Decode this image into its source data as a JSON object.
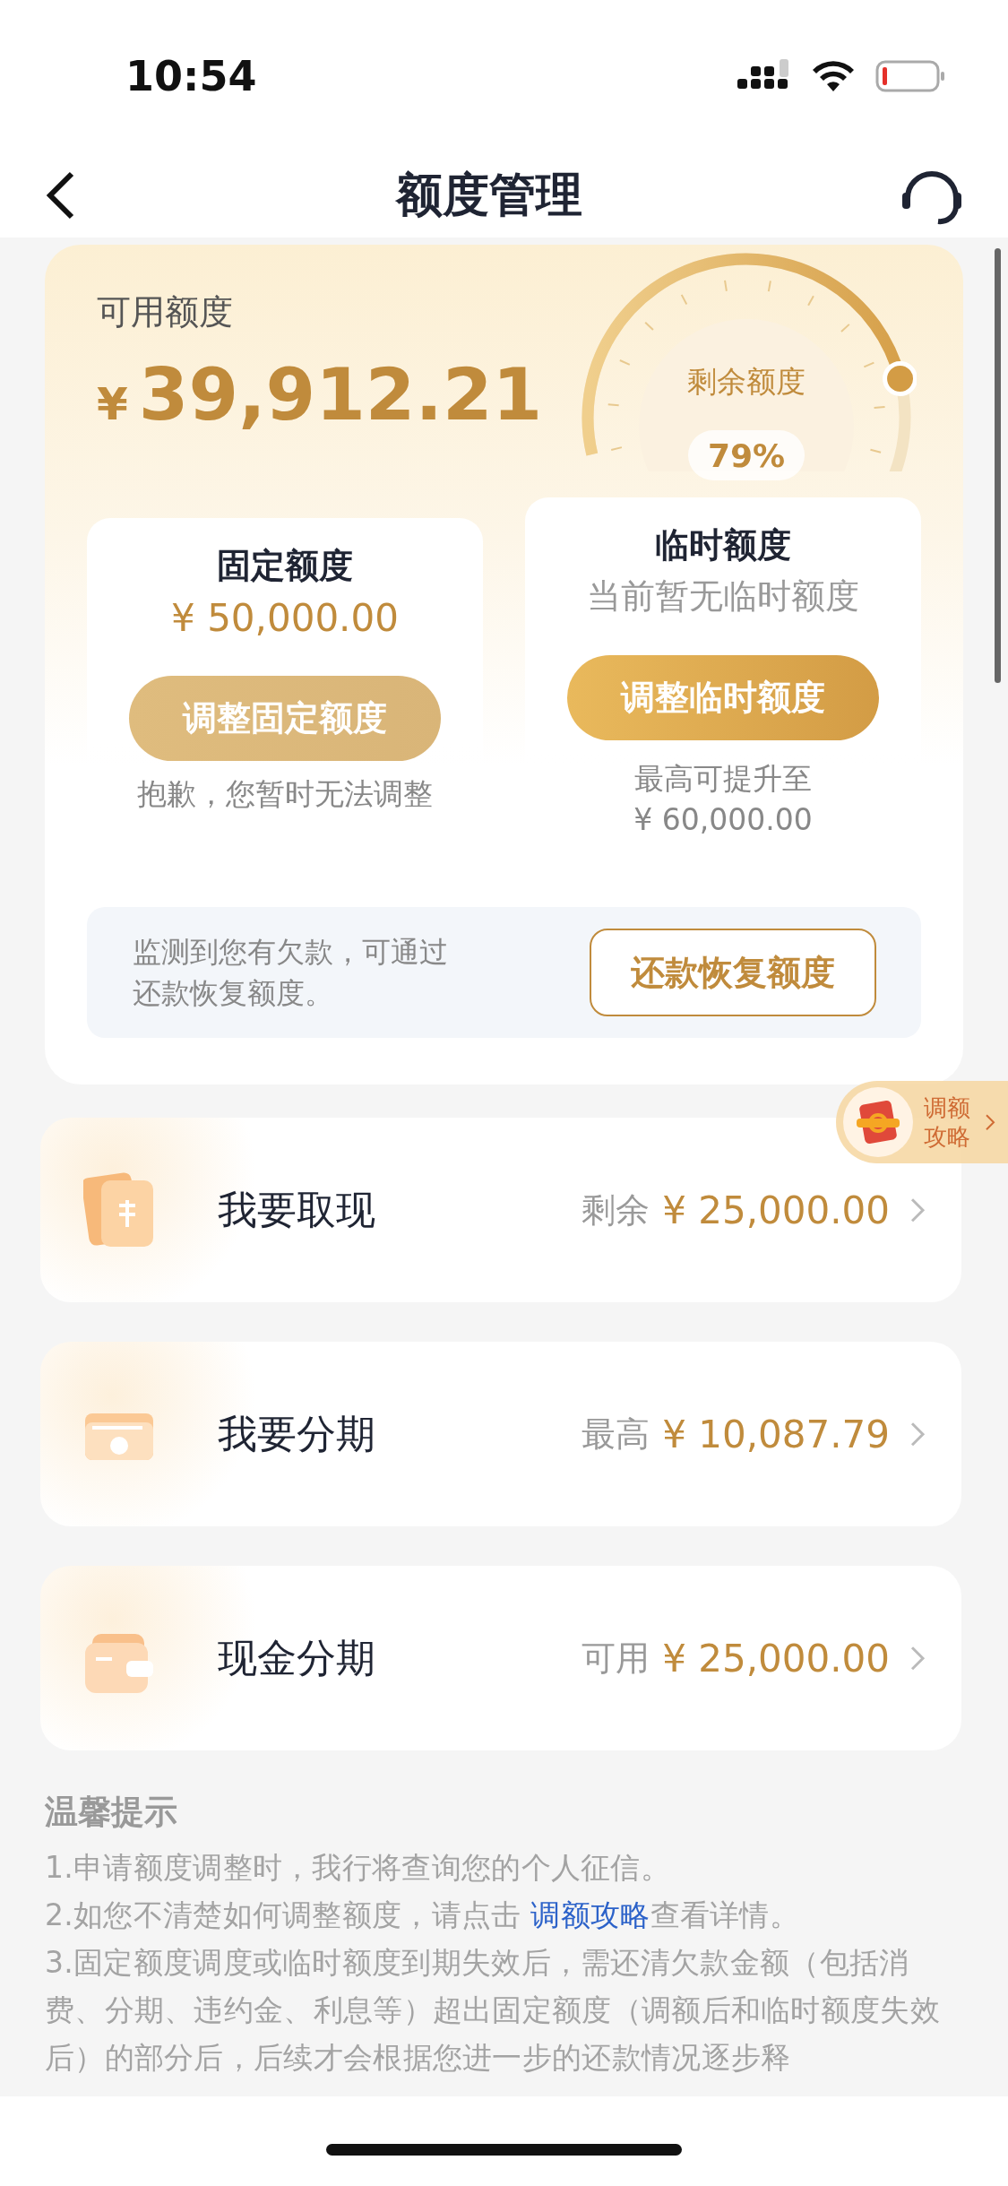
{
  "status_bar": {
    "time": "10:54"
  },
  "nav": {
    "title": "额度管理"
  },
  "summary": {
    "label": "可用额度",
    "currency": "¥",
    "amount": "39,912.21",
    "gauge": {
      "label": "剩余额度",
      "percent": "79%"
    }
  },
  "fixed": {
    "title": "固定额度",
    "amount": "¥ 50,000.00",
    "button": {
      "label": "调整固定额度",
      "disabled": true
    },
    "note": "抱歉，您暂时无法调整"
  },
  "temporary": {
    "title": "临时额度",
    "subtitle": "当前暂无临时额度",
    "button": {
      "label": "调整临时额度",
      "disabled": false
    },
    "note_lines": [
      "最高可提升至",
      "¥ 60,000.00"
    ]
  },
  "notice": {
    "text": "监测到您有欠款，可通过还款恢复额度。",
    "button": "还款恢复额度"
  },
  "guide_tag": {
    "label": "调额攻略"
  },
  "actions": [
    {
      "kind": "cash",
      "title": "我要取现",
      "prefix": "剩余",
      "amount": "¥ 25,000.00"
    },
    {
      "kind": "installment",
      "title": "我要分期",
      "prefix": "最高",
      "amount": "¥ 10,087.79"
    },
    {
      "kind": "wallet",
      "title": "现金分期",
      "prefix": "可用",
      "amount": "¥ 25,000.00"
    }
  ],
  "tips": {
    "title": "温馨提示",
    "items": [
      {
        "text": "1.申请额度调整时，我行将查询您的个人征信。"
      },
      {
        "text": "2.如您不清楚如何调整额度，请点击 ",
        "link": "调额攻略",
        "after": "查看详情。"
      },
      {
        "text": "3.固定额度调度或临时额度到期失效后，需还清欠款金额（包括消费、分期、违约金、利息等）超出固定额度（调额后和临时额度失效后）的部分后，后续才会根据您进一步的还款情况逐步释"
      }
    ]
  }
}
